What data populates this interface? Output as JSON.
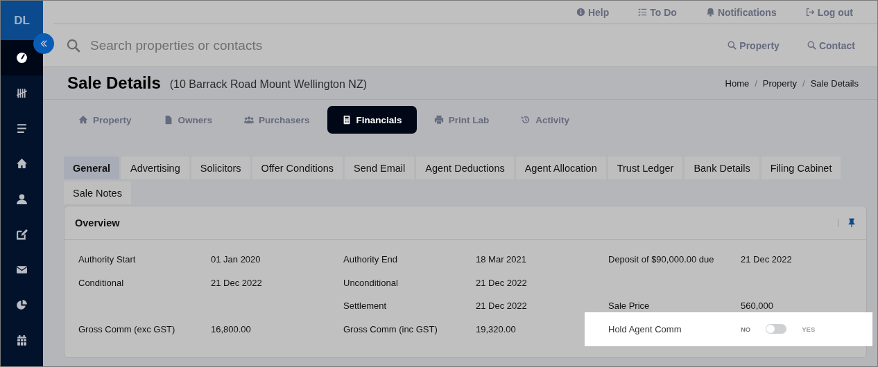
{
  "sidebar": {
    "avatar": "DL",
    "items": [
      {
        "kind": "dashboard",
        "selected": true
      },
      {
        "kind": "tally",
        "selected": false
      },
      {
        "kind": "list",
        "selected": false
      },
      {
        "kind": "home",
        "selected": false
      },
      {
        "kind": "person",
        "selected": false
      },
      {
        "kind": "edit",
        "selected": false
      },
      {
        "kind": "mail",
        "selected": false
      },
      {
        "kind": "pie",
        "selected": false
      },
      {
        "kind": "calendar",
        "selected": false
      }
    ]
  },
  "top_links": [
    {
      "kind": "info",
      "label": "Help"
    },
    {
      "kind": "todo",
      "label": "To Do"
    },
    {
      "kind": "bell",
      "label": "Notifications"
    },
    {
      "kind": "logout",
      "label": "Log out"
    }
  ],
  "search": {
    "placeholder": "Search properties or contacts",
    "buttons": [
      "Property",
      "Contact"
    ]
  },
  "page": {
    "title": "Sale Details",
    "subtitle": "(10 Barrack Road Mount Wellington NZ)",
    "breadcrumb": [
      "Home",
      "Property",
      "Sale Details"
    ],
    "breadcrumb_separator": "/"
  },
  "main_tabs": [
    {
      "kind": "home",
      "label": "Property",
      "selected": false
    },
    {
      "kind": "file",
      "label": "Owners",
      "selected": false
    },
    {
      "kind": "users",
      "label": "Purchasers",
      "selected": false
    },
    {
      "kind": "calculator",
      "label": "Financials",
      "selected": true
    },
    {
      "kind": "print",
      "label": "Print Lab",
      "selected": false
    },
    {
      "kind": "history",
      "label": "Activity",
      "selected": false
    }
  ],
  "sub_tabs": [
    {
      "label": "General",
      "selected": true
    },
    {
      "label": "Advertising",
      "selected": false
    },
    {
      "label": "Solicitors",
      "selected": false
    },
    {
      "label": "Offer Conditions",
      "selected": false
    },
    {
      "label": "Send Email",
      "selected": false
    },
    {
      "label": "Agent Deductions",
      "selected": false
    },
    {
      "label": "Agent Allocation",
      "selected": false
    },
    {
      "label": "Trust Ledger",
      "selected": false
    },
    {
      "label": "Bank Details",
      "selected": false
    },
    {
      "label": "Filing Cabinet",
      "selected": false
    },
    {
      "label": "Sale Notes",
      "selected": false
    }
  ],
  "overview": {
    "title": "Overview",
    "rows": [
      [
        {
          "label": "Authority Start",
          "value": "01 Jan 2020"
        },
        {
          "label": "Authority End",
          "value": "18 Mar 2021"
        },
        {
          "label": "Deposit of $90,000.00 due",
          "value": "21 Dec 2022"
        }
      ],
      [
        {
          "label": "Conditional",
          "value": "21 Dec 2022"
        },
        {
          "label": "Unconditional",
          "value": "21 Dec 2022"
        },
        null
      ],
      [
        null,
        {
          "label": "Settlement",
          "value": "21 Dec 2022"
        },
        {
          "label": "Sale Price",
          "value": "560,000"
        }
      ],
      [
        {
          "label": "Gross Comm (exc GST)",
          "value": "16,800.00"
        },
        {
          "label": "Gross Comm (inc GST)",
          "value": "19,320.00"
        },
        {
          "kind": "toggle",
          "label": "Hold Agent Comm",
          "off_label": "NO",
          "on_label": "YES",
          "on": false,
          "highlighted": true
        }
      ]
    ]
  }
}
